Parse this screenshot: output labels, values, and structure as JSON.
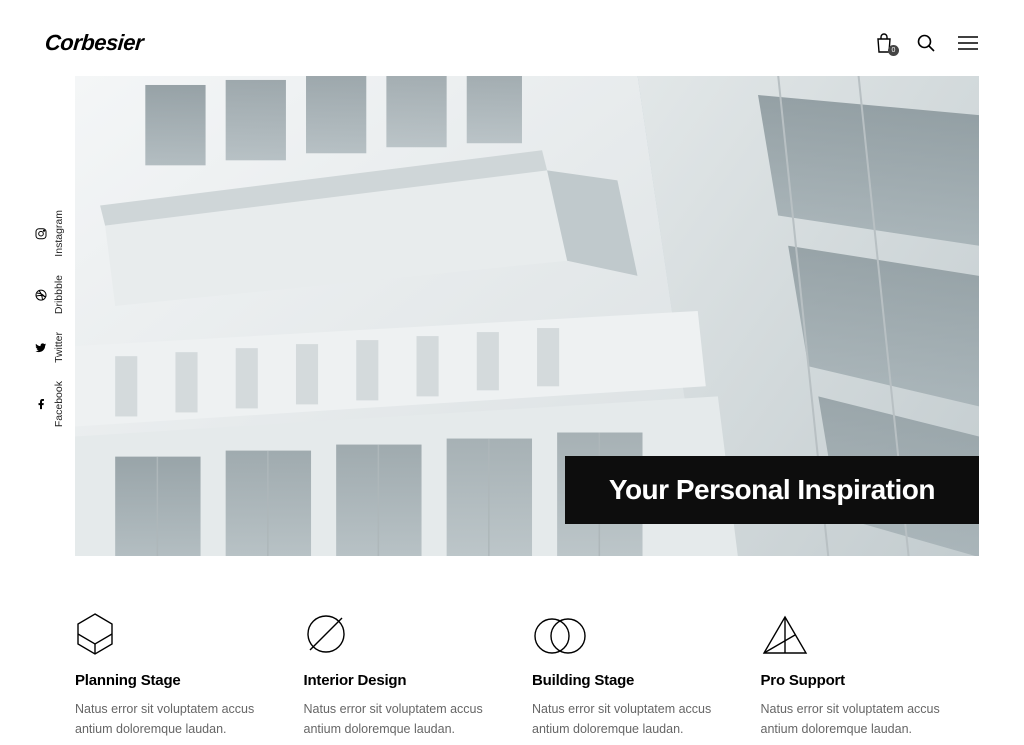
{
  "header": {
    "logo": "Corbesier",
    "cart_count": "0"
  },
  "social": [
    {
      "label": "Instagram",
      "icon": "instagram"
    },
    {
      "label": "Dribbble",
      "icon": "dribbble"
    },
    {
      "label": "Twitter",
      "icon": "twitter"
    },
    {
      "label": "Facebook",
      "icon": "facebook"
    }
  ],
  "hero": {
    "title": "Your Personal Inspiration"
  },
  "features": [
    {
      "title": "Planning Stage",
      "desc": "Natus error sit voluptatem accus antium doloremque laudan."
    },
    {
      "title": "Interior Design",
      "desc": "Natus error sit voluptatem accus antium doloremque laudan."
    },
    {
      "title": "Building Stage",
      "desc": "Natus error sit voluptatem accus antium doloremque laudan."
    },
    {
      "title": "Pro Support",
      "desc": "Natus error sit voluptatem accus antium doloremque laudan."
    }
  ]
}
